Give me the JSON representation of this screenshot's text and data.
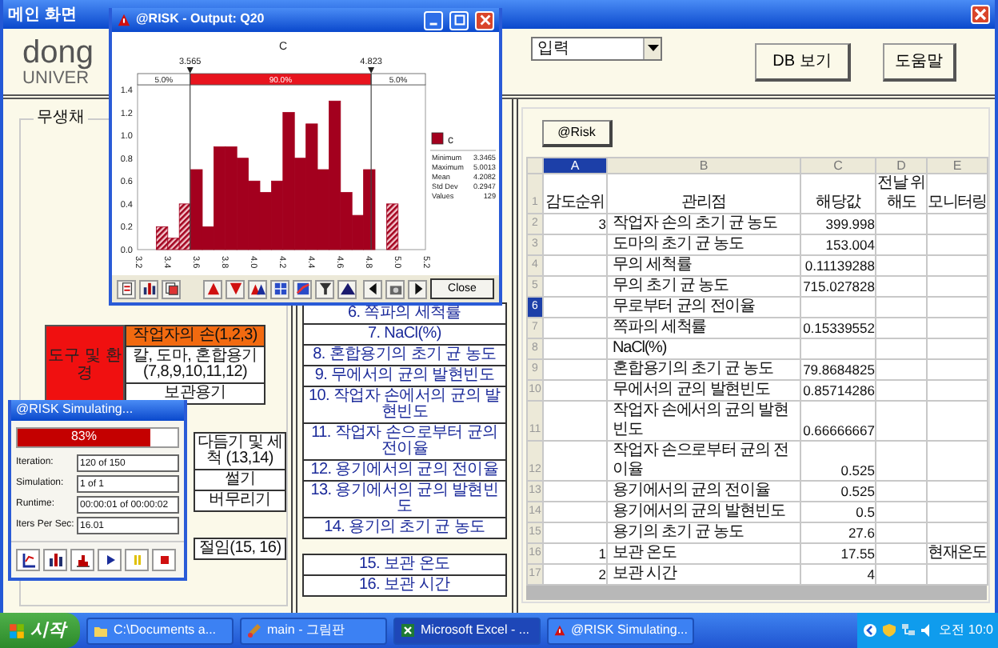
{
  "main_window": {
    "title": "메인 화면"
  },
  "header": {
    "logo_lines": [
      "dong",
      "UNIVER"
    ],
    "dropdown": {
      "value": "입력"
    },
    "buttons": [
      "DB 보기",
      "도움말"
    ]
  },
  "left_group": {
    "title": "무생채",
    "category": "도구 및 환경",
    "items": [
      {
        "label": "작업자의 손(1,2,3)",
        "highlighted": true
      },
      {
        "label": "칼, 도마, 혼합용기 (7,8,9,10,11,12)",
        "highlighted": false
      },
      {
        "label": "보관용기",
        "highlighted": false
      }
    ],
    "process_steps": [
      "다듬기 및 세척 (13,14)",
      "썰기",
      "버무리기"
    ],
    "pickling": "절임(15, 16)"
  },
  "middle_list": {
    "items": [
      "6. 쪽파의 세척률",
      "7. NaCl(%)",
      "8. 혼합용기의 초기 균 농도",
      "9. 무에서의 균의 발현빈도",
      "10. 작업자 손에서의 균의 발현빈도",
      "11. 작업자 손으로부터 균의 전이율",
      "12. 용기에서의 균의 전이율",
      "13. 용기에서의 균의 발현빈도",
      "14. 용기의 초기 균 농도"
    ],
    "storage_items": [
      "15. 보관 온도",
      "16. 보관 시간"
    ]
  },
  "right_panel": {
    "risk_button": "@Risk",
    "sheet": {
      "columns": [
        {
          "letter": "A",
          "selected": true
        },
        {
          "letter": "B",
          "selected": false
        },
        {
          "letter": "C",
          "selected": false
        },
        {
          "letter": "D",
          "selected": false
        },
        {
          "letter": "E",
          "selected": false
        }
      ],
      "rows": [
        {
          "number": "1",
          "selected": false,
          "a": "감도순위",
          "b": "관리점",
          "c": "해당값",
          "d": "전날 위해도",
          "e": "모니터링"
        },
        {
          "number": "2",
          "selected": false,
          "a": "3",
          "b": "작업자 손의 초기 균 농도",
          "c": "399.998"
        },
        {
          "number": "3",
          "selected": false,
          "b": "도마의 초기 균 농도",
          "c": "153.004"
        },
        {
          "number": "4",
          "selected": false,
          "b": "무의 세척률",
          "c": "0.11139288"
        },
        {
          "number": "5",
          "selected": false,
          "b": "무의 초기 균 농도",
          "c": "715.027828"
        },
        {
          "number": "6",
          "selected": true,
          "b": "무로부터 균의 전이율"
        },
        {
          "number": "7",
          "selected": false,
          "b": "쪽파의 세척률",
          "c": "0.15339552"
        },
        {
          "number": "8",
          "selected": false,
          "b": "NaCl(%)"
        },
        {
          "number": "9",
          "selected": false,
          "b": "혼합용기의 초기 균 농도",
          "c": "79.8684825"
        },
        {
          "number": "10",
          "selected": false,
          "b": "무에서의 균의 발현빈도",
          "c": "0.85714286"
        },
        {
          "number": "11",
          "selected": false,
          "b": "작업자 손에서의 균의 발현빈도",
          "c": "0.66666667"
        },
        {
          "number": "12",
          "selected": false,
          "b": "작업자 손으로부터 균의 전이율",
          "c": "0.525"
        },
        {
          "number": "13",
          "selected": false,
          "b": "용기에서의 균의 전이율",
          "c": "0.525"
        },
        {
          "number": "14",
          "selected": false,
          "b": "용기에서의 균의 발현빈도",
          "c": "0.5"
        },
        {
          "number": "15",
          "selected": false,
          "b": "용기의 초기 균 농도",
          "c": "27.6"
        },
        {
          "number": "16",
          "selected": false,
          "a": "1",
          "b": "보관 온도",
          "c": "17.55",
          "e": "현재온도"
        },
        {
          "number": "17",
          "selected": false,
          "a": "2",
          "b": "보관 시간",
          "c": "4"
        }
      ]
    }
  },
  "histogram_window": {
    "title": "@RISK - Output: Q20",
    "chart_data": {
      "type": "bar",
      "title": "C",
      "x": [
        3.37,
        3.45,
        3.53,
        3.61,
        3.69,
        3.77,
        3.85,
        3.93,
        4.01,
        4.09,
        4.17,
        4.25,
        4.33,
        4.41,
        4.49,
        4.57,
        4.65,
        4.73,
        4.81,
        4.97
      ],
      "series": [
        {
          "name": "c",
          "color": "#a3001e",
          "values": [
            0.2,
            0.1,
            0.4,
            0.7,
            0.2,
            0.9,
            0.9,
            0.8,
            0.6,
            0.5,
            0.6,
            1.2,
            0.8,
            1.1,
            0.7,
            1.3,
            0.5,
            0.3,
            0.7,
            0.4
          ]
        }
      ],
      "xlim": [
        3.2,
        5.2
      ],
      "ylim": [
        0,
        1.4
      ],
      "ref_lines": [
        {
          "axis": "x",
          "value": 3.565,
          "label": "3.565"
        },
        {
          "axis": "x",
          "value": 4.823,
          "label": "4.823"
        }
      ],
      "xticks": [
        {
          "value": 3.2,
          "label": "3.2"
        },
        {
          "value": 3.4,
          "label": "3.4"
        },
        {
          "value": 3.6,
          "label": "3.6"
        },
        {
          "value": 3.8,
          "label": "3.8"
        },
        {
          "value": 4.0,
          "label": "4.0"
        },
        {
          "value": 4.2,
          "label": "4.2"
        },
        {
          "value": 4.4,
          "label": "4.4"
        },
        {
          "value": 4.6,
          "label": "4.6"
        },
        {
          "value": 4.8,
          "label": "4.8"
        },
        {
          "value": 5.0,
          "label": "5.0"
        },
        {
          "value": 5.2,
          "label": "5.2"
        }
      ],
      "yticks": [
        {
          "value": 0,
          "label": "0.0"
        },
        {
          "value": 0.2,
          "label": "0.2"
        },
        {
          "value": 0.4,
          "label": "0.4"
        },
        {
          "value": 0.6,
          "label": "0.6"
        },
        {
          "value": 0.8,
          "label": "0.8"
        },
        {
          "value": 1.0,
          "label": "1.0"
        },
        {
          "value": 1.2,
          "label": "1.2"
        },
        {
          "value": 1.4,
          "label": "1.4"
        }
      ]
    },
    "delimiters": {
      "shares": [
        "5.0%",
        "90.0%",
        "5.0%"
      ]
    },
    "legend": {
      "stats": [
        {
          "label": "Minimum",
          "value": "3.3465"
        },
        {
          "label": "Maximum",
          "value": "5.0013"
        },
        {
          "label": "Mean",
          "value": "4.2082"
        },
        {
          "label": "Std Dev",
          "value": "0.2947"
        },
        {
          "label": "Values",
          "value": "129"
        }
      ]
    },
    "close_button": "Close"
  },
  "simulation_window": {
    "title": "@RISK Simulating...",
    "progress": {
      "label": "83%",
      "level": 0.83
    },
    "fields": [
      {
        "label": "Iteration:",
        "value": "120 of 150"
      },
      {
        "label": "Simulation:",
        "value": "1 of 1"
      },
      {
        "label": "Runtime:",
        "value": "00:00:01 of 00:00:02"
      },
      {
        "label": "Iters Per Sec:",
        "value": "16.01"
      }
    ]
  },
  "taskbar": {
    "start": "시작",
    "tasks": [
      {
        "label": "C:\\Documents a...",
        "active": false,
        "kind": "folder"
      },
      {
        "label": "main - 그림판",
        "active": false,
        "kind": "paint"
      },
      {
        "label": "Microsoft Excel - ...",
        "active": true,
        "kind": "excel"
      },
      {
        "label": "@RISK Simulating...",
        "active": false,
        "kind": "risk"
      }
    ],
    "clock": "오전 10:0"
  }
}
